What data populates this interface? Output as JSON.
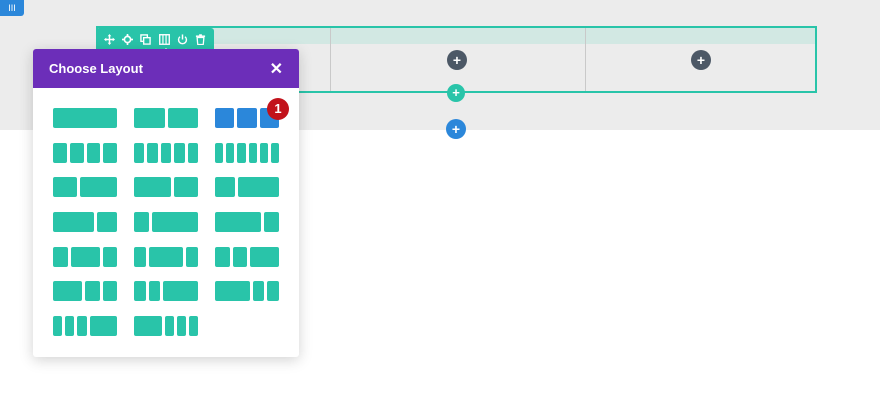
{
  "corner_tab": {
    "label": "III"
  },
  "toolbar": {
    "icons": [
      "move-icon",
      "gear-icon",
      "duplicate-icon",
      "columns-icon",
      "power-icon",
      "trash-icon"
    ]
  },
  "row": {
    "column_add_symbol": "+",
    "row_add_symbol": "+",
    "section_add_symbol": "+"
  },
  "modal": {
    "title": "Choose Layout",
    "close_symbol": "✕"
  },
  "badge": {
    "value": "1"
  },
  "colors": {
    "accent_green": "#29c4a9",
    "purple": "#6c2eb9",
    "blue": "#2b87da",
    "badge_red": "#c2121b",
    "dark": "#4c5866"
  },
  "layouts": [
    {
      "name": "1 column",
      "fractions": [
        1
      ]
    },
    {
      "name": "1/2 1/2",
      "fractions": [
        1,
        1
      ]
    },
    {
      "name": "1/3 1/3 1/3",
      "fractions": [
        1,
        1,
        1
      ],
      "selected": true
    },
    {
      "name": "1/4 x4",
      "fractions": [
        1,
        1,
        1,
        1
      ]
    },
    {
      "name": "1/5 x5",
      "fractions": [
        1,
        1,
        1,
        1,
        1
      ]
    },
    {
      "name": "1/6 x6",
      "fractions": [
        1,
        1,
        1,
        1,
        1,
        1
      ]
    },
    {
      "name": "2/5 3/5",
      "fractions": [
        2,
        3
      ]
    },
    {
      "name": "3/5 2/5",
      "fractions": [
        3,
        2
      ]
    },
    {
      "name": "1/3 2/3",
      "fractions": [
        1,
        2
      ]
    },
    {
      "name": "2/3 1/3",
      "fractions": [
        2,
        1
      ]
    },
    {
      "name": "1/4 3/4",
      "fractions": [
        1,
        3
      ]
    },
    {
      "name": "3/4 1/4",
      "fractions": [
        3,
        1
      ]
    },
    {
      "name": "1/4 1/2 1/4",
      "fractions": [
        1,
        2,
        1
      ]
    },
    {
      "name": "1/5 3/5 1/5",
      "fractions": [
        1,
        3,
        1
      ]
    },
    {
      "name": "1/4 1/4 1/2",
      "fractions": [
        1,
        1,
        2
      ]
    },
    {
      "name": "1/2 1/4 1/4",
      "fractions": [
        2,
        1,
        1
      ]
    },
    {
      "name": "1/5 1/5 3/5",
      "fractions": [
        1,
        1,
        3
      ]
    },
    {
      "name": "3/5 1/5 1/5",
      "fractions": [
        3,
        1,
        1
      ]
    },
    {
      "name": "1/6 1/6 1/6 1/2",
      "fractions": [
        1,
        1,
        1,
        3
      ]
    },
    {
      "name": "1/2 1/6 1/6 1/6",
      "fractions": [
        3,
        1,
        1,
        1
      ]
    }
  ]
}
